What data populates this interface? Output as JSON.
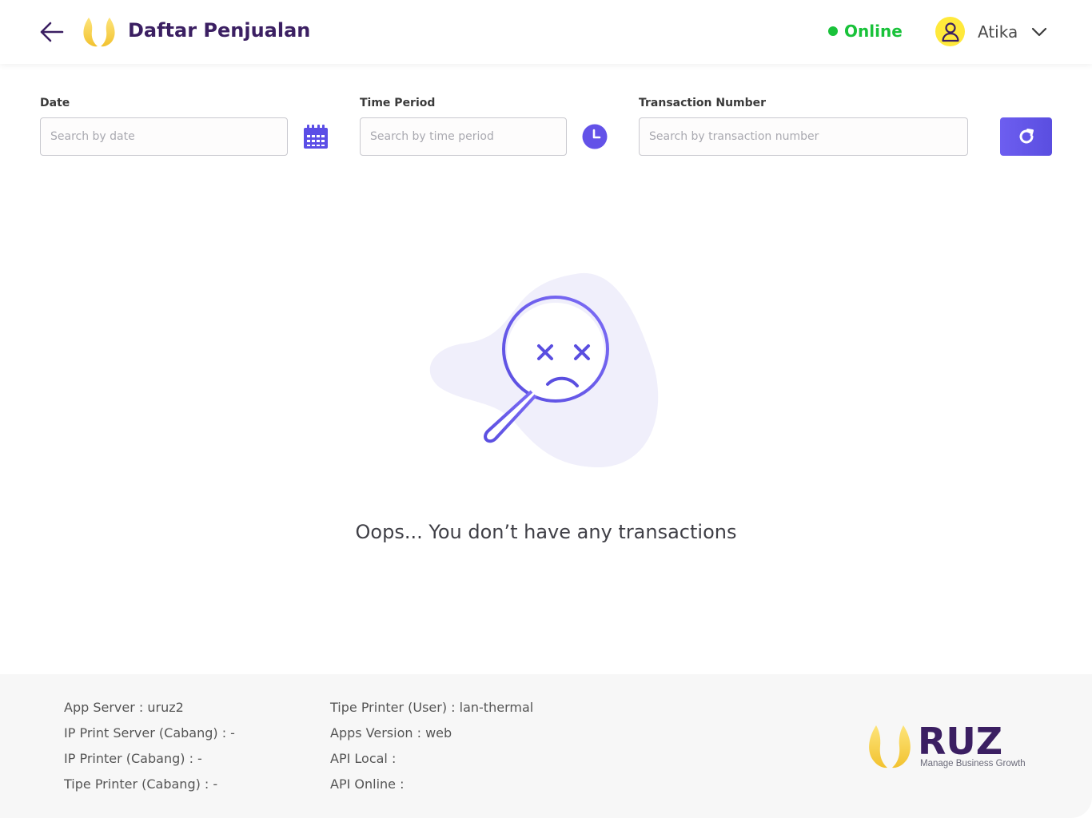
{
  "header": {
    "title": "Daftar Penjualan",
    "status": "Online",
    "user_name": "Atika"
  },
  "filters": {
    "date": {
      "label": "Date",
      "placeholder": "Search by date"
    },
    "time_period": {
      "label": "Time Period",
      "placeholder": "Search by time period"
    },
    "transaction_number": {
      "label": "Transaction Number",
      "placeholder": "Search by transaction number"
    }
  },
  "empty_state": {
    "message": "Oops... You don’t have any transactions"
  },
  "footer": {
    "left": [
      "App Server : uruz2",
      "IP Print Server (Cabang) : -",
      "IP Printer (Cabang) : -",
      "Tipe Printer (Cabang) : -"
    ],
    "right": [
      "Tipe Printer (User) : lan-thermal",
      "Apps Version : web",
      "API Local :",
      "API Online :"
    ],
    "brand": {
      "name": "RUZ",
      "tagline": "Manage Business Growth"
    }
  },
  "colors": {
    "primary": "#6d5ef0",
    "title": "#3b1f62",
    "online": "#19c23a",
    "logo_yellow": "#f5cf3a",
    "avatar": "#ffe93b"
  },
  "icons": [
    "back-arrow-icon",
    "logo-icon",
    "user-icon",
    "chevron-down-icon",
    "calendar-icon",
    "clock-icon",
    "refresh-icon",
    "magnifier-sad-icon"
  ]
}
